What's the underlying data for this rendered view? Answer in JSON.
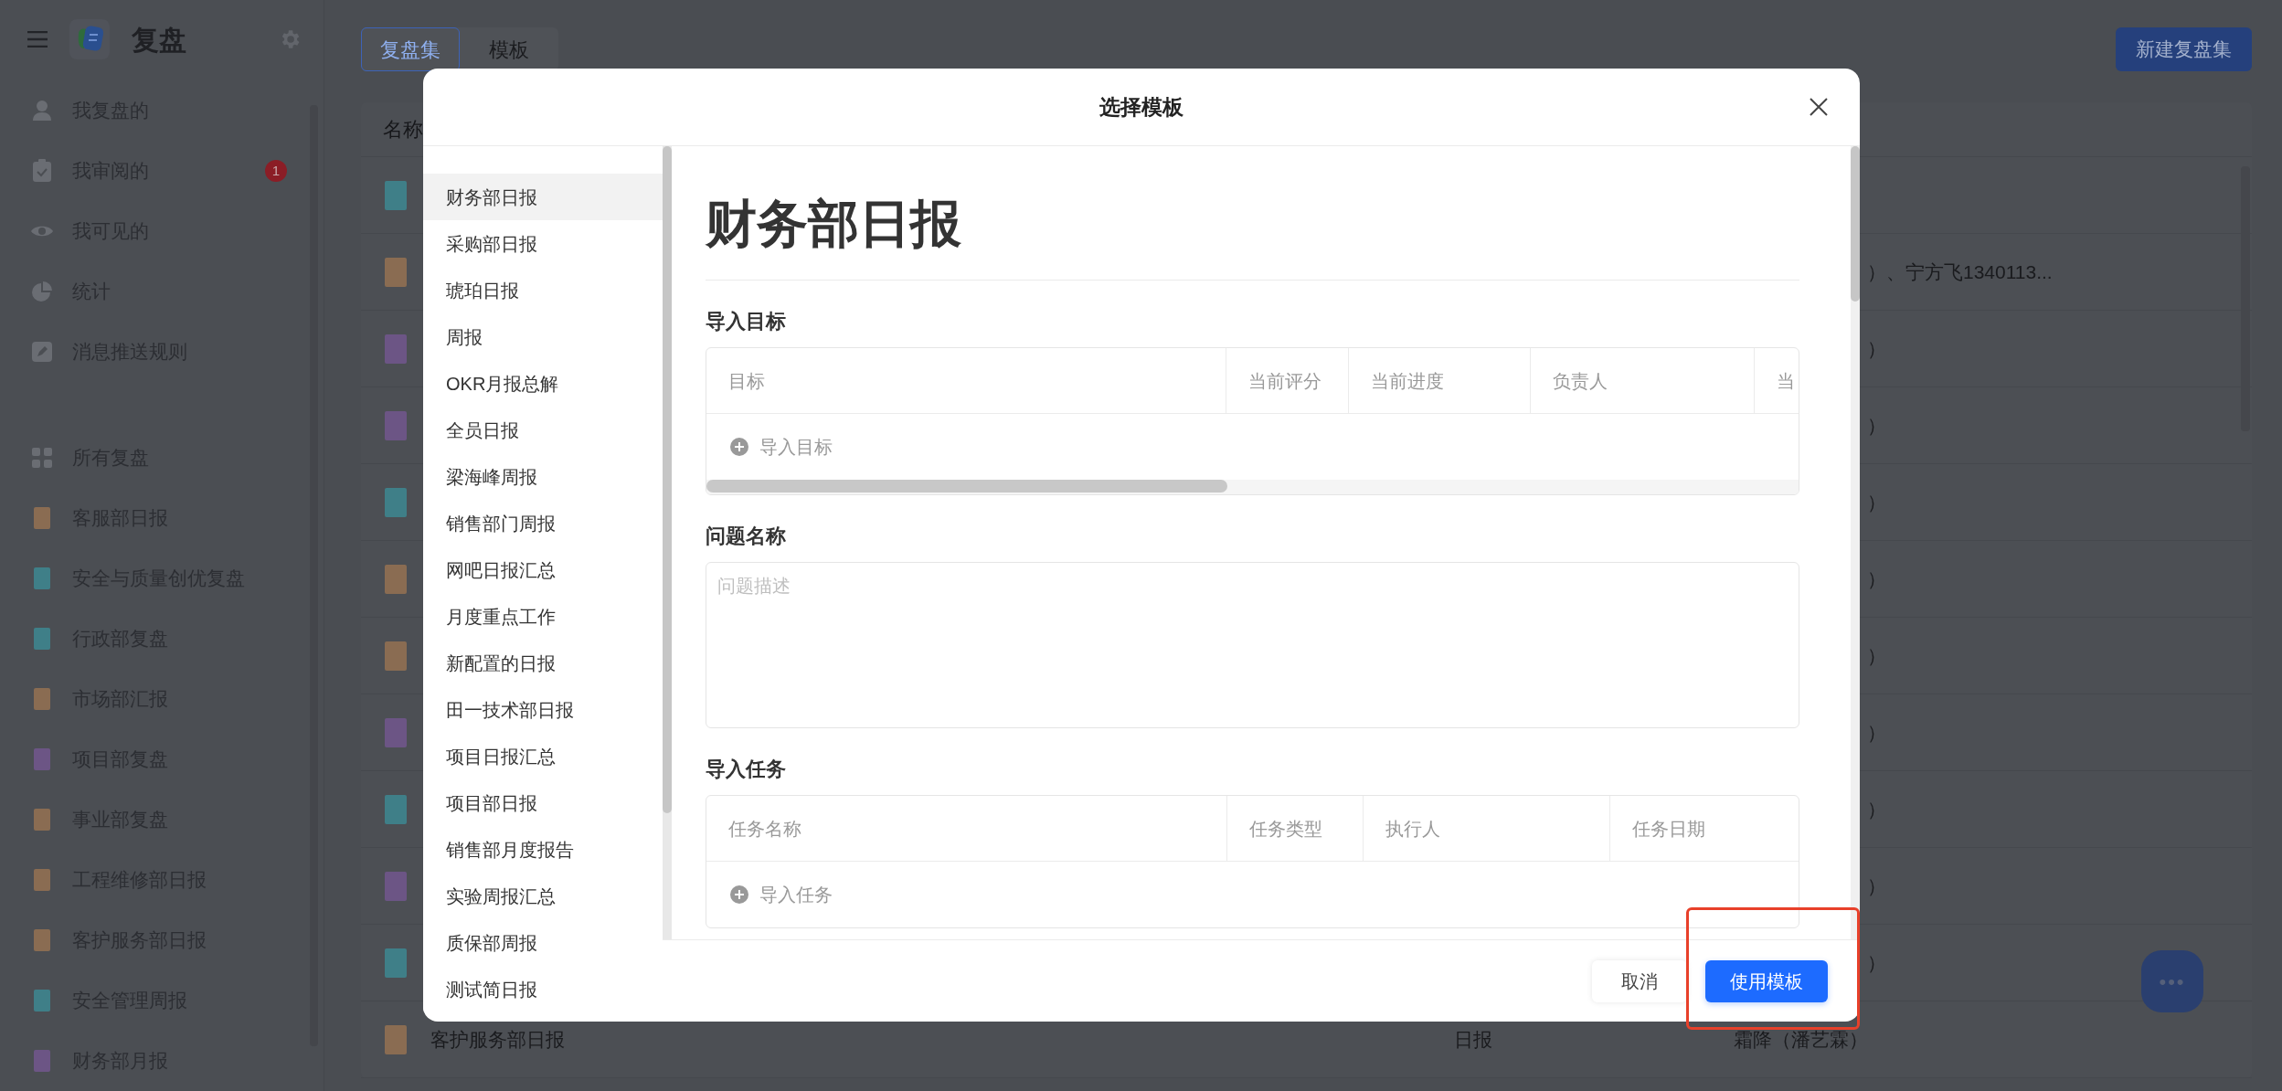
{
  "app": {
    "title": "复盘"
  },
  "sidebar": {
    "items": [
      {
        "kind": "user",
        "label": "我复盘的"
      },
      {
        "kind": "review",
        "label": "我审阅的",
        "badge": "1"
      },
      {
        "kind": "eye",
        "label": "我可见的"
      },
      {
        "kind": "stats",
        "label": "统计"
      },
      {
        "kind": "rules",
        "label": "消息推送规则"
      },
      {
        "kind": "all",
        "label": "所有复盘"
      },
      {
        "kind": "book",
        "label": "客服部日报",
        "color": "#8a6c52"
      },
      {
        "kind": "book",
        "label": "安全与质量创优复盘",
        "color": "#3f7f88"
      },
      {
        "kind": "book",
        "label": "行政部复盘",
        "color": "#3f7f88"
      },
      {
        "kind": "book",
        "label": "市场部汇报",
        "color": "#8a6c52"
      },
      {
        "kind": "book",
        "label": "项目部复盘",
        "color": "#6c5585"
      },
      {
        "kind": "book",
        "label": "事业部复盘",
        "color": "#8a6c52"
      },
      {
        "kind": "book",
        "label": "工程维修部日报",
        "color": "#8a6c52"
      },
      {
        "kind": "book",
        "label": "客护服务部日报",
        "color": "#8a6c52"
      },
      {
        "kind": "book",
        "label": "安全管理周报",
        "color": "#3f7f88"
      },
      {
        "kind": "book",
        "label": "财务部月报",
        "color": "#6c5585"
      }
    ]
  },
  "tabs": [
    {
      "label": "复盘集",
      "selected": true
    },
    {
      "label": "模板",
      "selected": false
    }
  ],
  "new_button": "新建复盘集",
  "table": {
    "columns": [
      "名称"
    ],
    "rows": [
      {
        "color": "#3f7f88"
      },
      {
        "color": "#8a6c52",
        "owner": "）、宁方飞1340113...",
        "partly_covered": true
      },
      {
        "color": "#6c5585",
        "owner": "）",
        "partly_covered": true
      },
      {
        "color": "#6c5585",
        "owner": "）",
        "partly_covered": true
      },
      {
        "color": "#3f7f88",
        "owner": "）",
        "partly_covered": true
      },
      {
        "color": "#8a6c52",
        "owner": "）",
        "partly_covered": true
      },
      {
        "color": "#8a6c52",
        "owner": "）",
        "partly_covered": true
      },
      {
        "color": "#6c5585",
        "owner": "）",
        "partly_covered": true
      },
      {
        "color": "#3f7f88",
        "owner": "）",
        "partly_covered": true
      },
      {
        "color": "#6c5585",
        "owner": "）",
        "partly_covered": true
      },
      {
        "color": "#3f7f88",
        "owner": "）",
        "partly_covered": true
      },
      {
        "color": "#8a6c52",
        "name": "客护服务部日报",
        "type": "日报",
        "owner": "霜降（潘艺霖）"
      }
    ]
  },
  "dialog": {
    "title": "选择模板",
    "templates": [
      {
        "label": "财务部日报",
        "selected": true
      },
      {
        "label": "采购部日报",
        "selected": false
      },
      {
        "label": "琥珀日报",
        "selected": false
      },
      {
        "label": "周报",
        "selected": false
      },
      {
        "label": "OKR月报总解",
        "selected": false
      },
      {
        "label": "全员日报",
        "selected": false
      },
      {
        "label": "梁海峰周报",
        "selected": false
      },
      {
        "label": "销售部门周报",
        "selected": false
      },
      {
        "label": "网吧日报汇总",
        "selected": false
      },
      {
        "label": "月度重点工作",
        "selected": false
      },
      {
        "label": "新配置的日报",
        "selected": false
      },
      {
        "label": "田一技术部日报",
        "selected": false
      },
      {
        "label": "项目日报汇总",
        "selected": false
      },
      {
        "label": "项目部日报",
        "selected": false
      },
      {
        "label": "销售部月度报告",
        "selected": false
      },
      {
        "label": "实验周报汇总",
        "selected": false
      },
      {
        "label": "质保部周报",
        "selected": false
      },
      {
        "label": "测试简日报",
        "selected": false
      }
    ],
    "preview": {
      "title": "财务部日报",
      "sections": [
        {
          "kind": "table",
          "heading": "导入目标",
          "columns": [
            "目标",
            "当前评分",
            "当前进度",
            "负责人",
            "当"
          ],
          "add": "导入目标"
        },
        {
          "kind": "text",
          "heading": "问题名称",
          "placeholder": "问题描述"
        },
        {
          "kind": "table",
          "heading": "导入任务",
          "columns": [
            "任务名称",
            "任务类型",
            "执行人",
            "任务日期"
          ],
          "add": "导入任务"
        }
      ]
    },
    "cancel": "取消",
    "confirm": {
      "label": "使用模板",
      "highlighted": true
    }
  },
  "fab": {
    "label": "•••"
  }
}
